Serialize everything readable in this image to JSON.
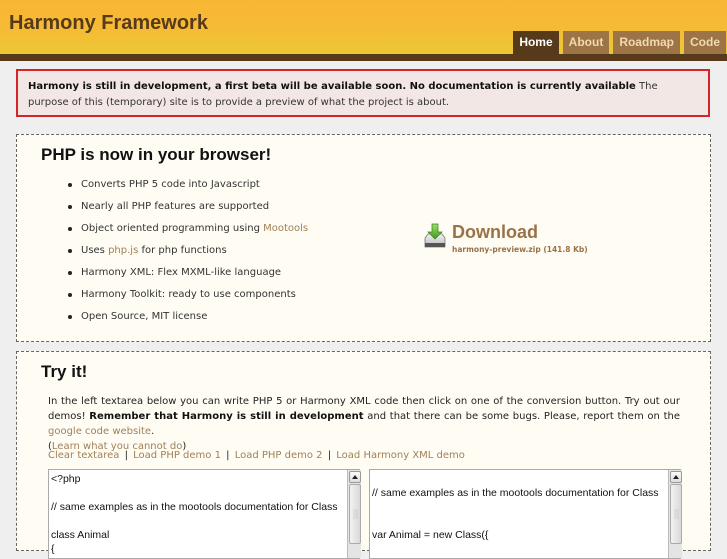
{
  "header": {
    "title": "Harmony Framework",
    "nav": [
      {
        "label": "Home",
        "active": true
      },
      {
        "label": "About",
        "active": false
      },
      {
        "label": "Roadmap",
        "active": false
      },
      {
        "label": "Code",
        "active": false
      }
    ]
  },
  "notice": {
    "bold": "Harmony is still in development, a first beta will be available soon. No documentation is currently available",
    "text": " The purpose of this (temporary) site is to provide a preview of what the project is about."
  },
  "features": {
    "title": "PHP is now in your browser!",
    "items": [
      {
        "text": "Converts PHP 5 code into Javascript"
      },
      {
        "text": "Nearly all PHP features are supported"
      },
      {
        "pre": "Object oriented programming using ",
        "link": "Mootools",
        "post": ""
      },
      {
        "pre": "Uses ",
        "link": "php.js",
        "post": " for php functions"
      },
      {
        "text": "Harmony XML: Flex MXML-like language"
      },
      {
        "text": "Harmony Toolkit: ready to use components"
      },
      {
        "text": "Open Source, MIT license"
      }
    ],
    "download": {
      "icon": "download-drive-icon",
      "label": "Download",
      "file": "harmony-preview.zip (141.8 Kb)"
    }
  },
  "try": {
    "title": "Try it!",
    "intro_1": "In the left textarea below you can write PHP 5 or Harmony XML code then click on one of the conversion button. Try out our demos! ",
    "intro_bold": "Remember that Harmony is still in development",
    "intro_2": " and that there can be some bugs. Please, report them on the ",
    "intro_link": "google code website",
    "intro_3": ".",
    "learn_open": "(",
    "learn_link": "Learn what you cannot do",
    "learn_close": ")",
    "links": [
      "Clear textarea",
      "Load PHP demo 1",
      "Load PHP demo 2",
      "Load Harmony XML demo"
    ],
    "separator": "|",
    "php_code": "<?php\n\n// same examples as in the mootools documentation for Class\n\nclass Animal\n{",
    "js_code": "\n// same examples as in the mootools documentation for Class\n\n\nvar Animal = new Class({"
  }
}
